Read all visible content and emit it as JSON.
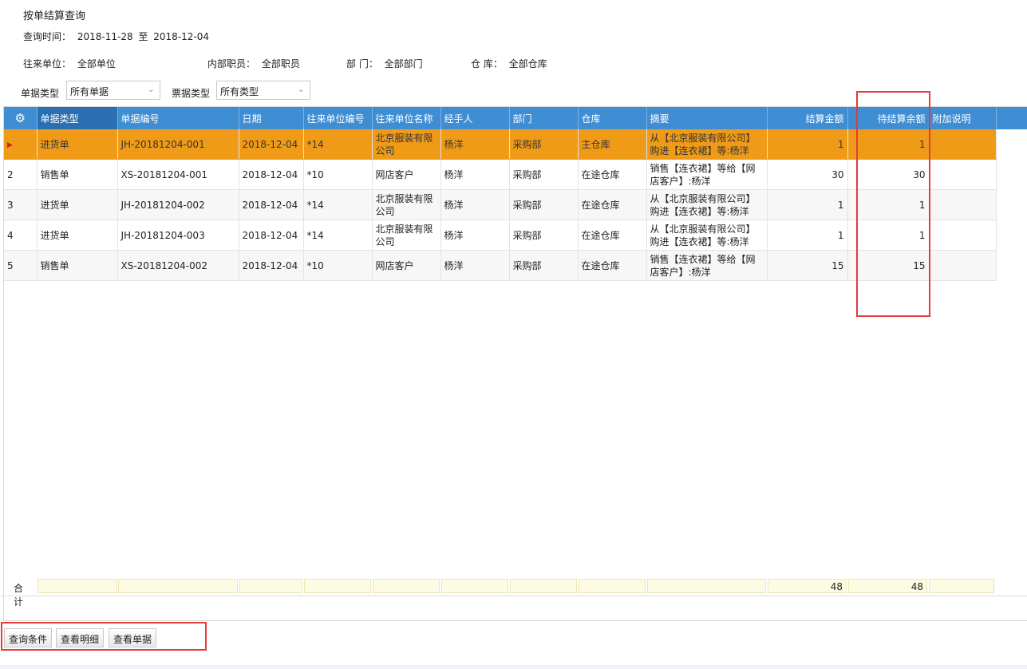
{
  "page": {
    "title": "按单结算查询",
    "query_time_label": "查询时间：",
    "date_from": "2018-11-28",
    "date_to_sep": "至",
    "date_to": "2018-12-04"
  },
  "filters": {
    "partner_label": "往来单位：",
    "partner_value": "全部单位",
    "staff_label": "内部职员：",
    "staff_value": "全部职员",
    "dept_label": "部 门：",
    "dept_value": "全部部门",
    "warehouse_label": "仓 库：",
    "warehouse_value": "全部仓库",
    "doc_type_label": "单据类型",
    "doc_type_value": "所有单据",
    "bill_type_label": "票据类型",
    "bill_type_value": "所有类型"
  },
  "table": {
    "columns": [
      "单据类型",
      "单据编号",
      "日期",
      "往来单位编号",
      "往来单位名称",
      "经手人",
      "部门",
      "仓库",
      "摘要",
      "结算金额",
      "待结算余额",
      "附加说明"
    ],
    "rows": [
      {
        "idx": "",
        "type": "进货单",
        "no": "JH-20181204-001",
        "date": "2018-12-04",
        "partner_no": "*14",
        "partner_name": "北京服装有限公司",
        "handler": "杨洋",
        "dept": "采购部",
        "warehouse": "主仓库",
        "summary": "从【北京服装有限公司】购进【连衣裙】等:杨洋",
        "amount": "1",
        "balance": "1",
        "note": ""
      },
      {
        "idx": "2",
        "type": "销售单",
        "no": "XS-20181204-001",
        "date": "2018-12-04",
        "partner_no": "*10",
        "partner_name": "网店客户",
        "handler": "杨洋",
        "dept": "采购部",
        "warehouse": "在途仓库",
        "summary": "销售【连衣裙】等给【网店客户】:杨洋",
        "amount": "30",
        "balance": "30",
        "note": ""
      },
      {
        "idx": "3",
        "type": "进货单",
        "no": "JH-20181204-002",
        "date": "2018-12-04",
        "partner_no": "*14",
        "partner_name": "北京服装有限公司",
        "handler": "杨洋",
        "dept": "采购部",
        "warehouse": "在途仓库",
        "summary": "从【北京服装有限公司】购进【连衣裙】等:杨洋",
        "amount": "1",
        "balance": "1",
        "note": ""
      },
      {
        "idx": "4",
        "type": "进货单",
        "no": "JH-20181204-003",
        "date": "2018-12-04",
        "partner_no": "*14",
        "partner_name": "北京服装有限公司",
        "handler": "杨洋",
        "dept": "采购部",
        "warehouse": "在途仓库",
        "summary": "从【北京服装有限公司】购进【连衣裙】等:杨洋",
        "amount": "1",
        "balance": "1",
        "note": ""
      },
      {
        "idx": "5",
        "type": "销售单",
        "no": "XS-20181204-002",
        "date": "2018-12-04",
        "partner_no": "*10",
        "partner_name": "网店客户",
        "handler": "杨洋",
        "dept": "采购部",
        "warehouse": "在途仓库",
        "summary": "销售【连衣裙】等给【网店客户】:杨洋",
        "amount": "15",
        "balance": "15",
        "note": ""
      }
    ],
    "footer": {
      "label": "合计",
      "amount_total": "48",
      "balance_total": "48"
    }
  },
  "buttons": {
    "query": "查询条件",
    "detail": "查看明细",
    "document": "查看单据"
  },
  "icons": {
    "settings": "gear-icon",
    "current_row": "triangle-right-icon",
    "dropdown": "chevron-down-icon"
  },
  "colors": {
    "header": "#3f8dd3",
    "selected_row": "#f09b18",
    "highlight_box": "#e53b3b"
  }
}
